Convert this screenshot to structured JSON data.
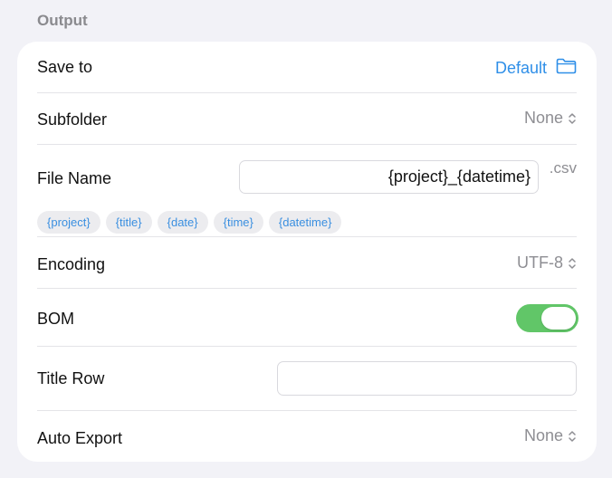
{
  "section": {
    "title": "Output"
  },
  "rows": {
    "save_to": {
      "label": "Save to",
      "value": "Default",
      "icon": "folder-icon"
    },
    "subfolder": {
      "label": "Subfolder",
      "value": "None"
    },
    "file_name": {
      "label": "File Name",
      "value": "{project}_{datetime}",
      "extension": ".csv",
      "tokens": [
        "{project}",
        "{title}",
        "{date}",
        "{time}",
        "{datetime}"
      ]
    },
    "encoding": {
      "label": "Encoding",
      "value": "UTF-8"
    },
    "bom": {
      "label": "BOM",
      "enabled": true
    },
    "title_row": {
      "label": "Title Row",
      "value": ""
    },
    "auto_export": {
      "label": "Auto Export",
      "value": "None"
    }
  },
  "colors": {
    "accent": "#2f8fe8",
    "toggle_on": "#61c668",
    "background": "#f2f2f7"
  }
}
